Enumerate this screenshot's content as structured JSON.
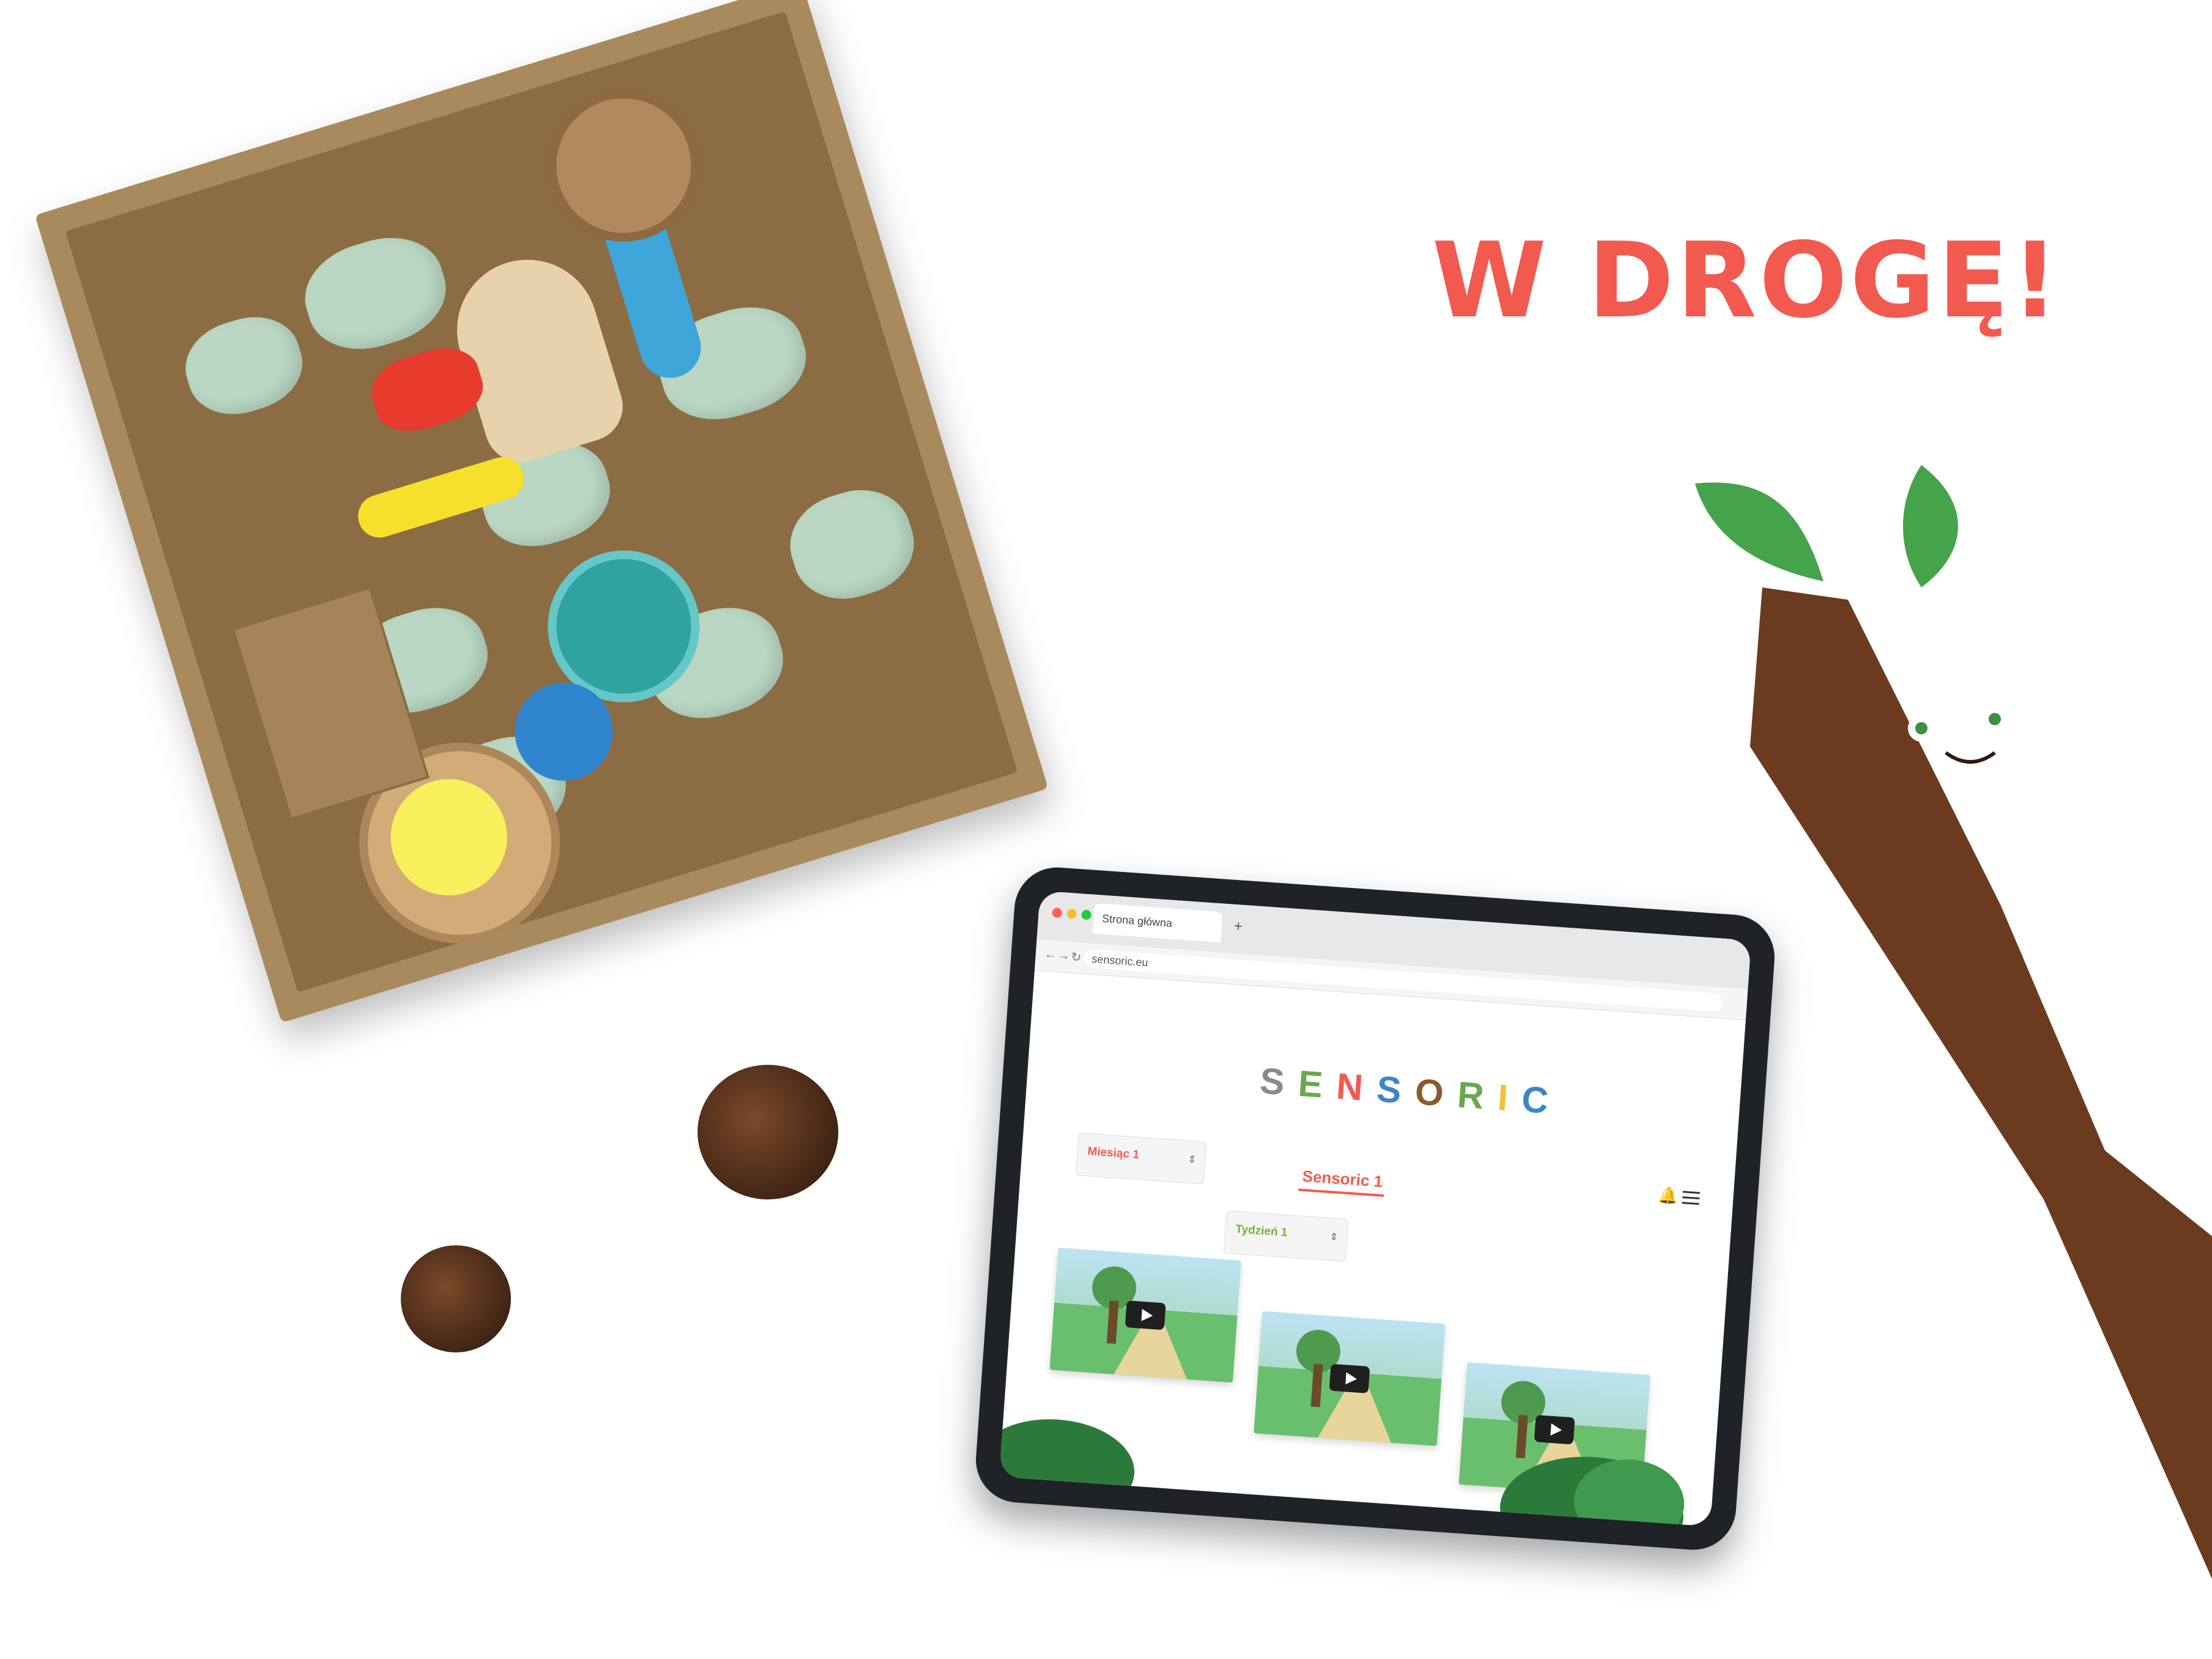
{
  "headline": "W DROGĘ!",
  "browser": {
    "tab_title": "Strona główna",
    "new_tab_icon": "+",
    "url": "sensoric.eu"
  },
  "site": {
    "logo_letters": [
      "S",
      "E",
      "N",
      "S",
      "O",
      "R",
      "I",
      "C"
    ],
    "month_select": {
      "label": "Miesiąc 1",
      "color": "#f25a50"
    },
    "week_select": {
      "label": "Tydzień 1",
      "color": "#76b13f"
    },
    "section_title": "Sensoric 1",
    "bell_icon": "🔔",
    "videos": [
      {
        "name": "video-1"
      },
      {
        "name": "video-2"
      },
      {
        "name": "video-3"
      }
    ]
  },
  "colors": {
    "accent": "#f25a50",
    "green": "#76b13f",
    "tablet": "#1f2226"
  }
}
